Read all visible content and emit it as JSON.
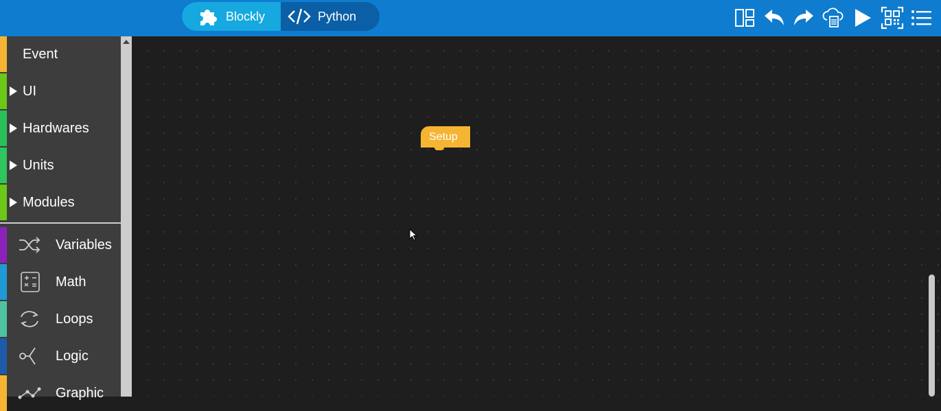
{
  "header": {
    "mode_toggle": {
      "blockly_label": "Blockly",
      "python_label": "Python",
      "active": "Blockly"
    },
    "toolbar_icons": [
      "layout-icon",
      "undo-icon",
      "redo-icon",
      "cloud-upload-icon",
      "run-icon",
      "qr-code-icon",
      "menu-icon"
    ]
  },
  "sidebar": {
    "items": [
      {
        "label": "Event",
        "color": "#f5b532"
      },
      {
        "label": "UI",
        "color": "#6cc817"
      },
      {
        "label": "Hardwares",
        "color": "#29c05a"
      },
      {
        "label": "Units",
        "color": "#2ec45e"
      },
      {
        "label": "Modules",
        "color": "#6cc817"
      },
      {
        "label": "Variables",
        "color": "#8b22b8",
        "icon": "shuffle-icon"
      },
      {
        "label": "Math",
        "color": "#1f9ad6",
        "icon": "calculator-icon"
      },
      {
        "label": "Loops",
        "color": "#4dc3a3",
        "icon": "loop-icon"
      },
      {
        "label": "Logic",
        "color": "#1e5aa8",
        "icon": "logic-branch-icon"
      },
      {
        "label": "Graphic",
        "color": "#f5b532",
        "icon": "graph-icon"
      }
    ]
  },
  "workspace": {
    "blocks": [
      {
        "label": "Setup",
        "color": "#f5b532"
      }
    ]
  }
}
